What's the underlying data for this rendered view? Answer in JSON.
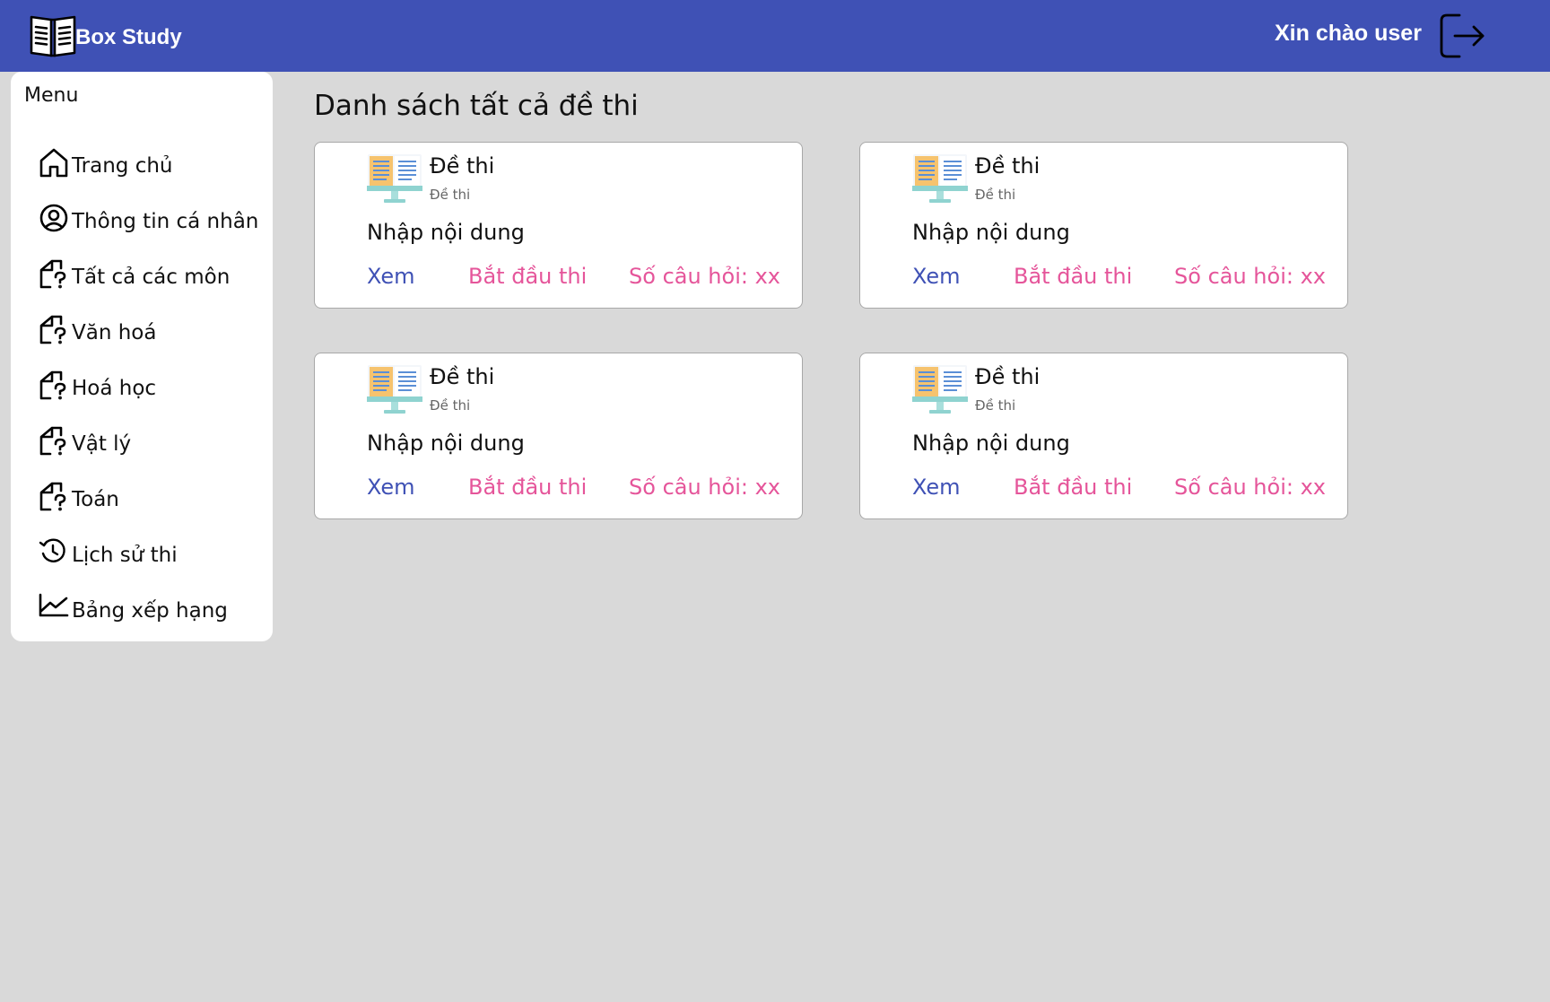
{
  "header": {
    "brand": "Box Study",
    "greeting": "Xin chào user",
    "logout_icon": "logout-icon"
  },
  "sidebar": {
    "title": "Menu",
    "items": [
      {
        "label": "Trang chủ",
        "icon": "home-icon"
      },
      {
        "label": "Thông tin cá nhân",
        "icon": "user-circle-icon"
      },
      {
        "label": "Tất cả các môn",
        "icon": "file-question-icon"
      },
      {
        "label": "Văn hoá",
        "icon": "file-question-icon"
      },
      {
        "label": "Hoá học",
        "icon": "file-question-icon"
      },
      {
        "label": "Vật lý",
        "icon": "file-question-icon"
      },
      {
        "label": "Toán",
        "icon": "file-question-icon"
      },
      {
        "label": "Lịch sử thi",
        "icon": "history-icon"
      },
      {
        "label": "Bảng xếp hạng",
        "icon": "line-chart-icon"
      }
    ]
  },
  "main": {
    "title": "Danh sách tất cả đề thi",
    "cards": [
      {
        "title": "Đề thi",
        "subtitle": "Đề thi",
        "content": "Nhập nội dung",
        "view": "Xem",
        "start": "Bắt đầu thi",
        "count": "Số câu hỏi: xx"
      },
      {
        "title": "Đề thi",
        "subtitle": "Đề thi",
        "content": "Nhập nội dung",
        "view": "Xem",
        "start": "Bắt đầu thi",
        "count": "Số câu hỏi: xx"
      },
      {
        "title": "Đề thi",
        "subtitle": "Đề thi",
        "content": "Nhập nội dung",
        "view": "Xem",
        "start": "Bắt đầu thi",
        "count": "Số câu hỏi: xx"
      },
      {
        "title": "Đề thi",
        "subtitle": "Đề thi",
        "content": "Nhập nội dung",
        "view": "Xem",
        "start": "Bắt đầu thi",
        "count": "Số câu hỏi: xx"
      }
    ]
  },
  "colors": {
    "header": "#3f51b5",
    "background": "#d9d9d9",
    "link_primary": "#3f51b5",
    "link_accent": "#e5559a"
  }
}
